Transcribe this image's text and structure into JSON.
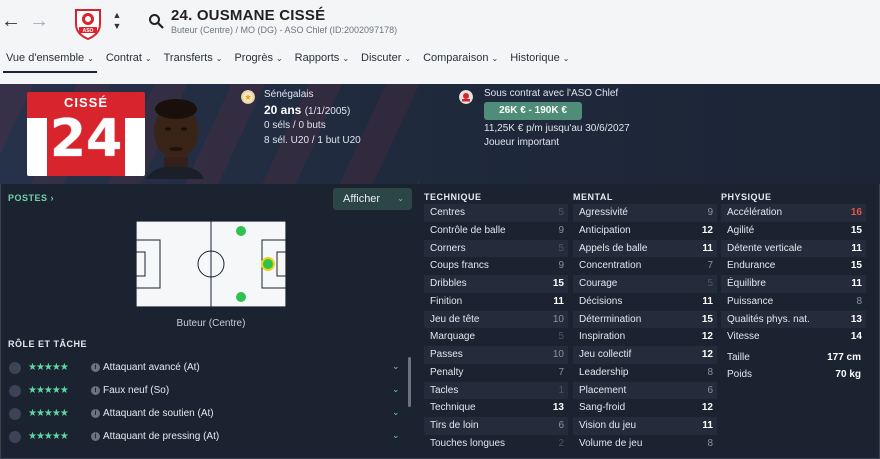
{
  "nav": {
    "back_glyph": "←",
    "forward_glyph": "→",
    "up_glyph": "▲",
    "down_glyph": "▼"
  },
  "club_badge": {
    "icon": "club-crest-icon",
    "text": "ASO"
  },
  "player": {
    "title": "24. OUSMANE CISSÉ",
    "subtitle": "Buteur (Centre) / MO (DG) - ASO Chlef (ID:2002097178)"
  },
  "menu": [
    {
      "label": "Vue d'ensemble",
      "active": true
    },
    {
      "label": "Contrat"
    },
    {
      "label": "Transferts"
    },
    {
      "label": "Progrès"
    },
    {
      "label": "Rapports"
    },
    {
      "label": "Discuter"
    },
    {
      "label": "Comparaison"
    },
    {
      "label": "Historique"
    }
  ],
  "shirt": {
    "name": "CISSÉ",
    "number": "24"
  },
  "bio": {
    "nationality": "Sénégalais",
    "age": "20 ans",
    "birthdate": "(1/1/2005)",
    "caps": "0 séls / 0 buts",
    "youth": "8 sél. U20 / 1 but U20"
  },
  "contract": {
    "club_line": "Sous contrat avec l'ASO Chlef",
    "value_range": "26K € - 190K €",
    "wage_line": "11,25K € p/m jusqu'au 30/6/2027",
    "role": "Joueur important"
  },
  "positions": {
    "label": "POSTES",
    "button": "Afficher",
    "caption": "Buteur (Centre)"
  },
  "roles": {
    "label": "RÔLE ET TÂCHE",
    "items": [
      {
        "stars": "★★★★★",
        "name": "Attaquant avancé (At)"
      },
      {
        "stars": "★★★★★",
        "name": "Faux neuf (So)"
      },
      {
        "stars": "★★★★★",
        "name": "Attaquant de soutien (At)"
      },
      {
        "stars": "★★★★★",
        "name": "Attaquant de pressing (At)"
      }
    ]
  },
  "attributes": {
    "technique": {
      "label": "TECHNIQUE",
      "rows": [
        {
          "name": "Centres",
          "value": "5"
        },
        {
          "name": "Contrôle de balle",
          "value": "9"
        },
        {
          "name": "Corners",
          "value": "5"
        },
        {
          "name": "Coups francs",
          "value": "9"
        },
        {
          "name": "Dribbles",
          "value": "15"
        },
        {
          "name": "Finition",
          "value": "11"
        },
        {
          "name": "Jeu de tête",
          "value": "10"
        },
        {
          "name": "Marquage",
          "value": "5"
        },
        {
          "name": "Passes",
          "value": "10"
        },
        {
          "name": "Penalty",
          "value": "7"
        },
        {
          "name": "Tacles",
          "value": "1"
        },
        {
          "name": "Technique",
          "value": "13"
        },
        {
          "name": "Tirs de loin",
          "value": "6"
        },
        {
          "name": "Touches longues",
          "value": "2"
        }
      ]
    },
    "mental": {
      "label": "MENTAL",
      "rows": [
        {
          "name": "Agressivité",
          "value": "9"
        },
        {
          "name": "Anticipation",
          "value": "12"
        },
        {
          "name": "Appels de balle",
          "value": "11"
        },
        {
          "name": "Concentration",
          "value": "7"
        },
        {
          "name": "Courage",
          "value": "5"
        },
        {
          "name": "Décisions",
          "value": "11"
        },
        {
          "name": "Détermination",
          "value": "15"
        },
        {
          "name": "Inspiration",
          "value": "12"
        },
        {
          "name": "Jeu collectif",
          "value": "12"
        },
        {
          "name": "Leadership",
          "value": "8"
        },
        {
          "name": "Placement",
          "value": "6"
        },
        {
          "name": "Sang-froid",
          "value": "12"
        },
        {
          "name": "Vision du jeu",
          "value": "11"
        },
        {
          "name": "Volume de jeu",
          "value": "8"
        }
      ]
    },
    "physique": {
      "label": "PHYSIQUE",
      "rows": [
        {
          "name": "Accélération",
          "value": "16"
        },
        {
          "name": "Agilité",
          "value": "15"
        },
        {
          "name": "Détente verticale",
          "value": "11"
        },
        {
          "name": "Endurance",
          "value": "15"
        },
        {
          "name": "Équilibre",
          "value": "11"
        },
        {
          "name": "Puissance",
          "value": "8"
        },
        {
          "name": "Qualités phys. nat.",
          "value": "13"
        },
        {
          "name": "Vitesse",
          "value": "14"
        }
      ],
      "height_label": "Taille",
      "height_value": "177 cm",
      "weight_label": "Poids",
      "weight_value": "70 kg"
    }
  },
  "colors": {
    "accent": "#6fd2a7",
    "shirt": "#d8242c",
    "wage_badge": "#4f8d79",
    "high_attr": "#e8524a"
  }
}
